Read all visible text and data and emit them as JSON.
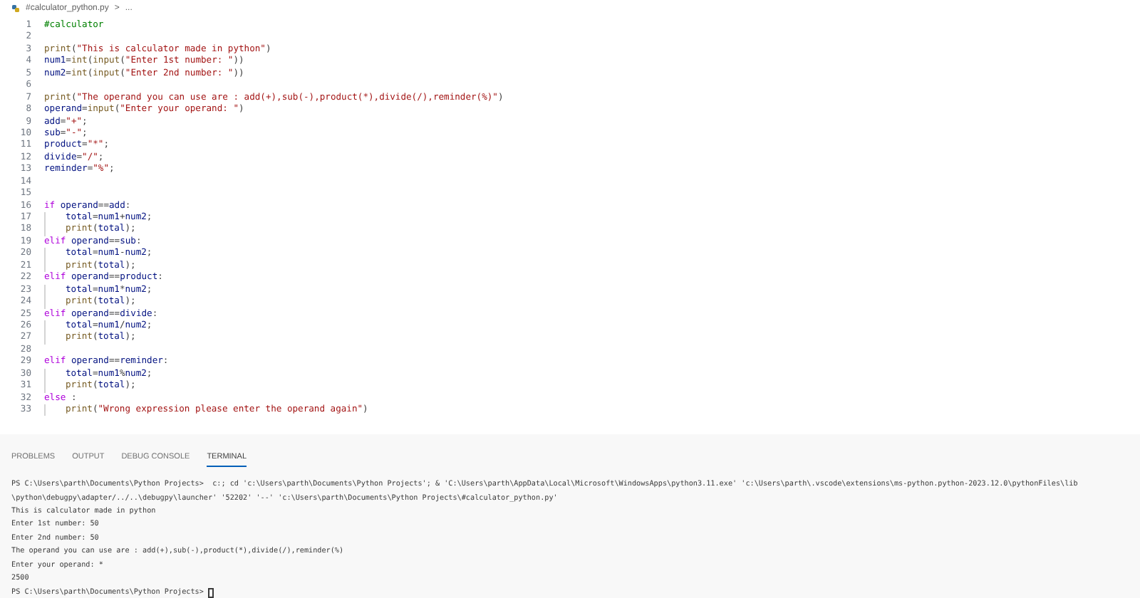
{
  "breadcrumb": {
    "file": "#calculator_python.py",
    "separator": ">",
    "more": "..."
  },
  "editor": {
    "lines": [
      {
        "number": "1",
        "indented": false,
        "segments": [
          {
            "kind": "comment",
            "text": "#calculator"
          }
        ]
      },
      {
        "number": "2",
        "indented": false
      },
      {
        "number": "3",
        "indented": false,
        "segments": [
          {
            "kind": "function",
            "text": "print"
          },
          {
            "kind": "plain",
            "text": "("
          },
          {
            "kind": "string",
            "text": "\"This is calculator made in python\""
          },
          {
            "kind": "plain",
            "text": ")"
          }
        ]
      },
      {
        "number": "4",
        "indented": false,
        "segments": [
          {
            "kind": "variable",
            "text": "num1"
          },
          {
            "kind": "plain",
            "text": "="
          },
          {
            "kind": "function",
            "text": "int"
          },
          {
            "kind": "plain",
            "text": "("
          },
          {
            "kind": "function",
            "text": "input"
          },
          {
            "kind": "plain",
            "text": "("
          },
          {
            "kind": "string",
            "text": "\"Enter 1st number: \""
          },
          {
            "kind": "plain",
            "text": "))"
          }
        ]
      },
      {
        "number": "5",
        "indented": false,
        "segments": [
          {
            "kind": "variable",
            "text": "num2"
          },
          {
            "kind": "plain",
            "text": "="
          },
          {
            "kind": "function",
            "text": "int"
          },
          {
            "kind": "plain",
            "text": "("
          },
          {
            "kind": "function",
            "text": "input"
          },
          {
            "kind": "plain",
            "text": "("
          },
          {
            "kind": "string",
            "text": "\"Enter 2nd number: \""
          },
          {
            "kind": "plain",
            "text": "))"
          }
        ]
      },
      {
        "number": "6",
        "indented": false
      },
      {
        "number": "7",
        "indented": false,
        "segments": [
          {
            "kind": "function",
            "text": "print"
          },
          {
            "kind": "plain",
            "text": "("
          },
          {
            "kind": "string",
            "text": "\"The operand you can use are : add(+),sub(-),product(*),divide(/),reminder(%)\""
          },
          {
            "kind": "plain",
            "text": ")"
          }
        ]
      },
      {
        "number": "8",
        "indented": false,
        "segments": [
          {
            "kind": "variable",
            "text": "operand"
          },
          {
            "kind": "plain",
            "text": "="
          },
          {
            "kind": "function",
            "text": "input"
          },
          {
            "kind": "plain",
            "text": "("
          },
          {
            "kind": "string",
            "text": "\"Enter your operand: \""
          },
          {
            "kind": "plain",
            "text": ")"
          }
        ]
      },
      {
        "number": "9",
        "indented": false,
        "segments": [
          {
            "kind": "variable",
            "text": "add"
          },
          {
            "kind": "plain",
            "text": "="
          },
          {
            "kind": "string",
            "text": "\"+\""
          },
          {
            "kind": "plain",
            "text": ";"
          }
        ]
      },
      {
        "number": "10",
        "indented": false,
        "segments": [
          {
            "kind": "variable",
            "text": "sub"
          },
          {
            "kind": "plain",
            "text": "="
          },
          {
            "kind": "string",
            "text": "\"-\""
          },
          {
            "kind": "plain",
            "text": ";"
          }
        ]
      },
      {
        "number": "11",
        "indented": false,
        "segments": [
          {
            "kind": "variable",
            "text": "product"
          },
          {
            "kind": "plain",
            "text": "="
          },
          {
            "kind": "string",
            "text": "\"*\""
          },
          {
            "kind": "plain",
            "text": ";"
          }
        ]
      },
      {
        "number": "12",
        "indented": false,
        "segments": [
          {
            "kind": "variable",
            "text": "divide"
          },
          {
            "kind": "plain",
            "text": "="
          },
          {
            "kind": "string",
            "text": "\"/\""
          },
          {
            "kind": "plain",
            "text": ";"
          }
        ]
      },
      {
        "number": "13",
        "indented": false,
        "segments": [
          {
            "kind": "variable",
            "text": "reminder"
          },
          {
            "kind": "plain",
            "text": "="
          },
          {
            "kind": "string",
            "text": "\"%\""
          },
          {
            "kind": "plain",
            "text": ";"
          }
        ]
      },
      {
        "number": "14",
        "indented": false
      },
      {
        "number": "15",
        "indented": false
      },
      {
        "number": "16",
        "indented": false,
        "segments": [
          {
            "kind": "keyword",
            "text": "if"
          },
          {
            "kind": "variable",
            "text": "operand"
          },
          {
            "kind": "plain",
            "text": "=="
          },
          {
            "kind": "variable",
            "text": "add"
          },
          {
            "kind": "plain",
            "text": ":"
          }
        ]
      },
      {
        "number": "17",
        "indented": true,
        "segments": [
          {
            "kind": "variable",
            "text": "total"
          },
          {
            "kind": "plain",
            "text": "="
          },
          {
            "kind": "variable",
            "text": "num1"
          },
          {
            "kind": "plain",
            "text": "+"
          },
          {
            "kind": "variable",
            "text": "num2"
          },
          {
            "kind": "plain",
            "text": ";"
          }
        ]
      },
      {
        "number": "18",
        "indented": true,
        "segments": [
          {
            "kind": "function",
            "text": "print"
          },
          {
            "kind": "plain",
            "text": "("
          },
          {
            "kind": "variable",
            "text": "total"
          },
          {
            "kind": "plain",
            "text": ");"
          }
        ]
      },
      {
        "number": "19",
        "indented": false,
        "segments": [
          {
            "kind": "keyword",
            "text": "elif"
          },
          {
            "kind": "variable",
            "text": "operand"
          },
          {
            "kind": "plain",
            "text": "=="
          },
          {
            "kind": "variable",
            "text": "sub"
          },
          {
            "kind": "plain",
            "text": ":"
          }
        ]
      },
      {
        "number": "20",
        "indented": true,
        "segments": [
          {
            "kind": "variable",
            "text": "total"
          },
          {
            "kind": "plain",
            "text": "="
          },
          {
            "kind": "variable",
            "text": "num1"
          },
          {
            "kind": "plain",
            "text": "-"
          },
          {
            "kind": "variable",
            "text": "num2"
          },
          {
            "kind": "plain",
            "text": ";"
          }
        ]
      },
      {
        "number": "21",
        "indented": true,
        "segments": [
          {
            "kind": "function",
            "text": "print"
          },
          {
            "kind": "plain",
            "text": "("
          },
          {
            "kind": "variable",
            "text": "total"
          },
          {
            "kind": "plain",
            "text": ");"
          }
        ]
      },
      {
        "number": "22",
        "indented": false,
        "segments": [
          {
            "kind": "keyword",
            "text": "elif"
          },
          {
            "kind": "variable",
            "text": "operand"
          },
          {
            "kind": "plain",
            "text": "=="
          },
          {
            "kind": "variable",
            "text": "product"
          },
          {
            "kind": "plain",
            "text": ":"
          }
        ]
      },
      {
        "number": "23",
        "indented": true,
        "segments": [
          {
            "kind": "variable",
            "text": "total"
          },
          {
            "kind": "plain",
            "text": "="
          },
          {
            "kind": "variable",
            "text": "num1"
          },
          {
            "kind": "plain",
            "text": "*"
          },
          {
            "kind": "variable",
            "text": "num2"
          },
          {
            "kind": "plain",
            "text": ";"
          }
        ]
      },
      {
        "number": "24",
        "indented": true,
        "segments": [
          {
            "kind": "function",
            "text": "print"
          },
          {
            "kind": "plain",
            "text": "("
          },
          {
            "kind": "variable",
            "text": "total"
          },
          {
            "kind": "plain",
            "text": ");"
          }
        ]
      },
      {
        "number": "25",
        "indented": false,
        "segments": [
          {
            "kind": "keyword",
            "text": "elif"
          },
          {
            "kind": "variable",
            "text": "operand"
          },
          {
            "kind": "plain",
            "text": "=="
          },
          {
            "kind": "variable",
            "text": "divide"
          },
          {
            "kind": "plain",
            "text": ":"
          }
        ]
      },
      {
        "number": "26",
        "indented": true,
        "segments": [
          {
            "kind": "variable",
            "text": "total"
          },
          {
            "kind": "plain",
            "text": "="
          },
          {
            "kind": "variable",
            "text": "num1"
          },
          {
            "kind": "plain",
            "text": "/"
          },
          {
            "kind": "variable",
            "text": "num2"
          },
          {
            "kind": "plain",
            "text": ";"
          }
        ]
      },
      {
        "number": "27",
        "indented": true,
        "segments": [
          {
            "kind": "function",
            "text": "print"
          },
          {
            "kind": "plain",
            "text": "("
          },
          {
            "kind": "variable",
            "text": "total"
          },
          {
            "kind": "plain",
            "text": ");"
          }
        ]
      },
      {
        "number": "28",
        "indented": false
      },
      {
        "number": "29",
        "indented": false,
        "segments": [
          {
            "kind": "keyword",
            "text": "elif"
          },
          {
            "kind": "variable",
            "text": "operand"
          },
          {
            "kind": "plain",
            "text": "=="
          },
          {
            "kind": "variable",
            "text": "reminder"
          },
          {
            "kind": "plain",
            "text": ":"
          }
        ]
      },
      {
        "number": "30",
        "indented": true,
        "segments": [
          {
            "kind": "variable",
            "text": "total"
          },
          {
            "kind": "plain",
            "text": "="
          },
          {
            "kind": "variable",
            "text": "num1"
          },
          {
            "kind": "plain",
            "text": "%"
          },
          {
            "kind": "variable",
            "text": "num2"
          },
          {
            "kind": "plain",
            "text": ";"
          }
        ]
      },
      {
        "number": "31",
        "indented": true,
        "segments": [
          {
            "kind": "function",
            "text": "print"
          },
          {
            "kind": "plain",
            "text": "("
          },
          {
            "kind": "variable",
            "text": "total"
          },
          {
            "kind": "plain",
            "text": ");"
          }
        ]
      },
      {
        "number": "32",
        "indented": false,
        "segments": [
          {
            "kind": "keyword",
            "text": "else"
          },
          {
            "kind": "plain",
            "text": ":"
          }
        ]
      },
      {
        "number": "33",
        "indented": true,
        "segments": [
          {
            "kind": "function",
            "text": "print"
          },
          {
            "kind": "plain",
            "text": "("
          },
          {
            "kind": "string",
            "text": "\"Wrong expression please enter the operand again\""
          },
          {
            "kind": "plain",
            "text": ")"
          }
        ]
      }
    ]
  },
  "panel": {
    "tabs": [
      {
        "label": "PROBLEMS",
        "selected": false
      },
      {
        "label": "OUTPUT",
        "selected": false
      },
      {
        "label": "DEBUG CONSOLE",
        "selected": false
      },
      {
        "label": "TERMINAL",
        "selected": true
      }
    ],
    "terminal_lines": [
      "PS C:\\Users\\parth\\Documents\\Python Projects>  c:; cd 'c:\\Users\\parth\\Documents\\Python Projects'; & 'C:\\Users\\parth\\AppData\\Local\\Microsoft\\WindowsApps\\python3.11.exe' 'c:\\Users\\parth\\.vscode\\extensions\\ms-python.python-2023.12.0\\pythonFiles\\lib",
      "\\python\\debugpy\\adapter/../..\\debugpy\\launcher' '52202' '--' 'c:\\Users\\parth\\Documents\\Python Projects\\#calculator_python.py'",
      "This is calculator made in python",
      "Enter 1st number: 50",
      "Enter 2nd number: 50",
      "The operand you can use are : add(+),sub(-),product(*),divide(/),reminder(%)",
      "Enter your operand: *",
      "2500"
    ],
    "prompt": "PS C:\\Users\\parth\\Documents\\Python Projects>"
  }
}
